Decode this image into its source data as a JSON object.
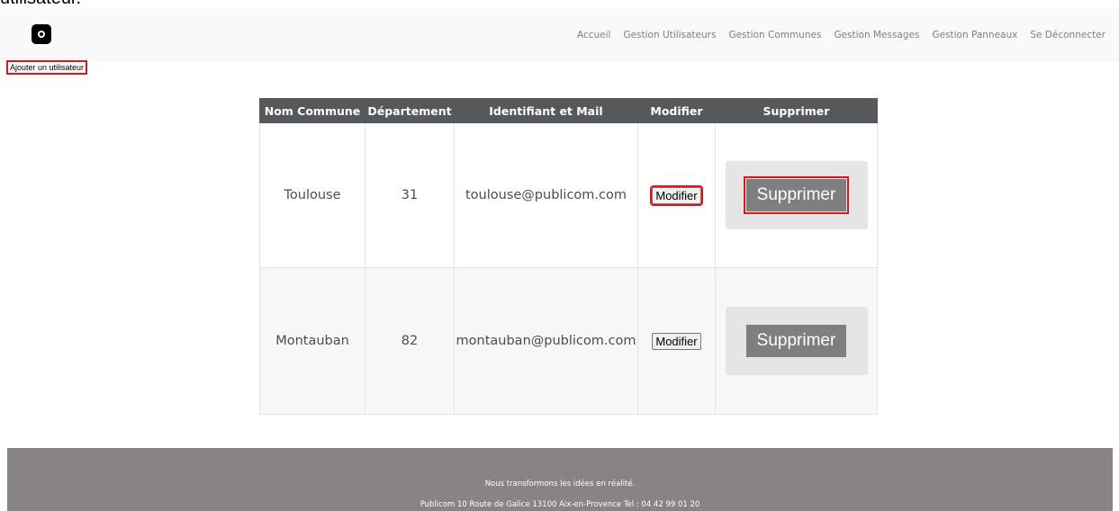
{
  "doc_fragment": "utilisateur.",
  "nav": {
    "links": [
      "Accueil",
      "Gestion Utilisateurs",
      "Gestion Communes",
      "Gestion Messages",
      "Gestion Panneaux",
      "Se Déconnecter"
    ]
  },
  "add_user_label": "Ajouter un utilisateur",
  "table": {
    "headers": [
      "Nom Commune",
      "Département",
      "Identifiant et Mail",
      "Modifier",
      "Supprimer"
    ],
    "rows": [
      {
        "commune": "Toulouse",
        "departement": "31",
        "mail": "toulouse@publicom.com",
        "modifier": "Modifier",
        "supprimer": "Supprimer"
      },
      {
        "commune": "Montauban",
        "departement": "82",
        "mail": "montauban@publicom.com",
        "modifier": "Modifier",
        "supprimer": "Supprimer"
      }
    ]
  },
  "footer": {
    "tagline": "Nous transformons les idées en réalité.",
    "address": "Publicom 10 Route de Galice 13100 Aix-en-Provence Tel : 04 42 99 01 20"
  },
  "colors": {
    "navbar_bg": "#f8f9fa",
    "header_bg": "#55595c",
    "footer_bg": "#898481",
    "highlight": "#e0141b"
  }
}
